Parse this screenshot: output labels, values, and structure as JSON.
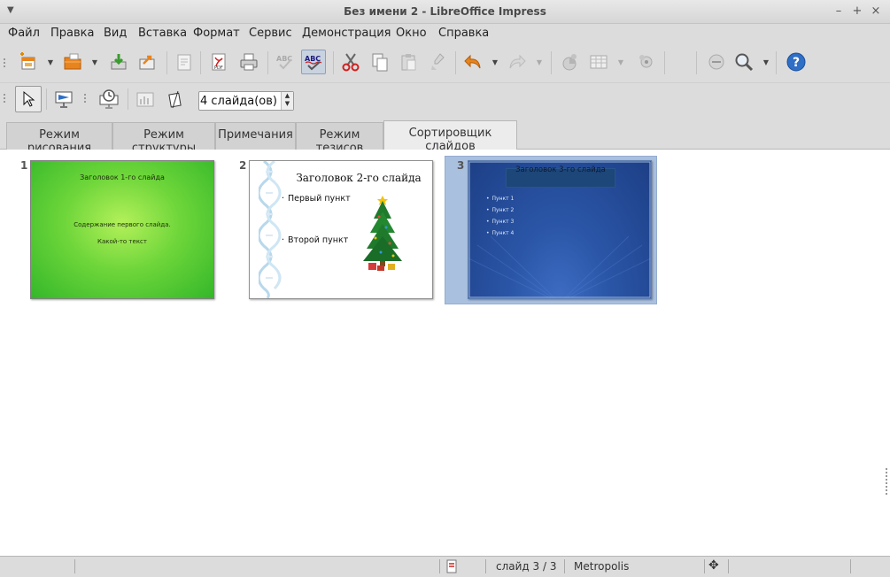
{
  "window": {
    "title": "Без имени 2 - LibreOffice Impress",
    "menu_icon": "chevron-down-icon",
    "controls": [
      "minimize-icon",
      "maximize-icon",
      "close-icon"
    ]
  },
  "menubar": {
    "items": [
      "Файл",
      "Правка",
      "Вид",
      "Вставка",
      "Формат",
      "Сервис",
      "Демонстрация",
      "Окно",
      "Справка"
    ]
  },
  "toolbar_standard": {
    "buttons": [
      "new-icon",
      "open-icon",
      "save-icon",
      "export-icon",
      "edit-file-icon",
      "export-pdf-icon",
      "print-icon",
      "spellcheck-icon",
      "autospellcheck-icon",
      "cut-icon",
      "copy-icon",
      "paste-icon",
      "clone-formatting-icon",
      "undo-icon",
      "redo-icon",
      "chart-icon",
      "table-icon",
      "navigator-icon",
      "zoom-off-icon",
      "zoom-icon",
      "help-icon"
    ]
  },
  "toolbar_slide_sorter": {
    "buttons": [
      "select-pointer-icon",
      "slide-show-icon",
      "rehearse-timings-icon",
      "slide-layout-icon",
      "slides-per-row-icon"
    ],
    "slides_per_row_value": "4 слайда(ов)"
  },
  "tabs": [
    {
      "label": "Режим рисования",
      "active": false
    },
    {
      "label": "Режим структуры",
      "active": false
    },
    {
      "label": "Примечания",
      "active": false
    },
    {
      "label": "Режим тезисов",
      "active": false
    },
    {
      "label": "Сортировщик слайдов",
      "active": true
    }
  ],
  "slides": [
    {
      "number": "1",
      "title": "Заголовок 1-го слайда",
      "body": [
        "Содержание первого слайда.",
        "Какой-то текст"
      ],
      "theme_colors": [
        "#b4f05a",
        "#34b72a"
      ]
    },
    {
      "number": "2",
      "title": "Заголовок 2-го слайда",
      "bullets": [
        "Первый пункт",
        "Второй пункт"
      ],
      "images": [
        "dna-helix-icon",
        "christmas-tree-icon"
      ]
    },
    {
      "number": "3",
      "title": "Заголовок 3-го слайда",
      "bullets": [
        "Пункт 1",
        "Пункт 2",
        "Пункт 3",
        "Пункт 4"
      ],
      "selected": true,
      "theme_colors": [
        "#1d3f86",
        "#3d6cc2"
      ]
    }
  ],
  "statusbar": {
    "slide_position": "слайд 3 / 3",
    "master_page": "Metropolis",
    "icons": [
      "document-modified-icon",
      "move-icon"
    ]
  },
  "colors": {
    "selection": "#a9c0df",
    "help_blue": "#2f6fc6",
    "accent_orange": "#e8841d"
  }
}
